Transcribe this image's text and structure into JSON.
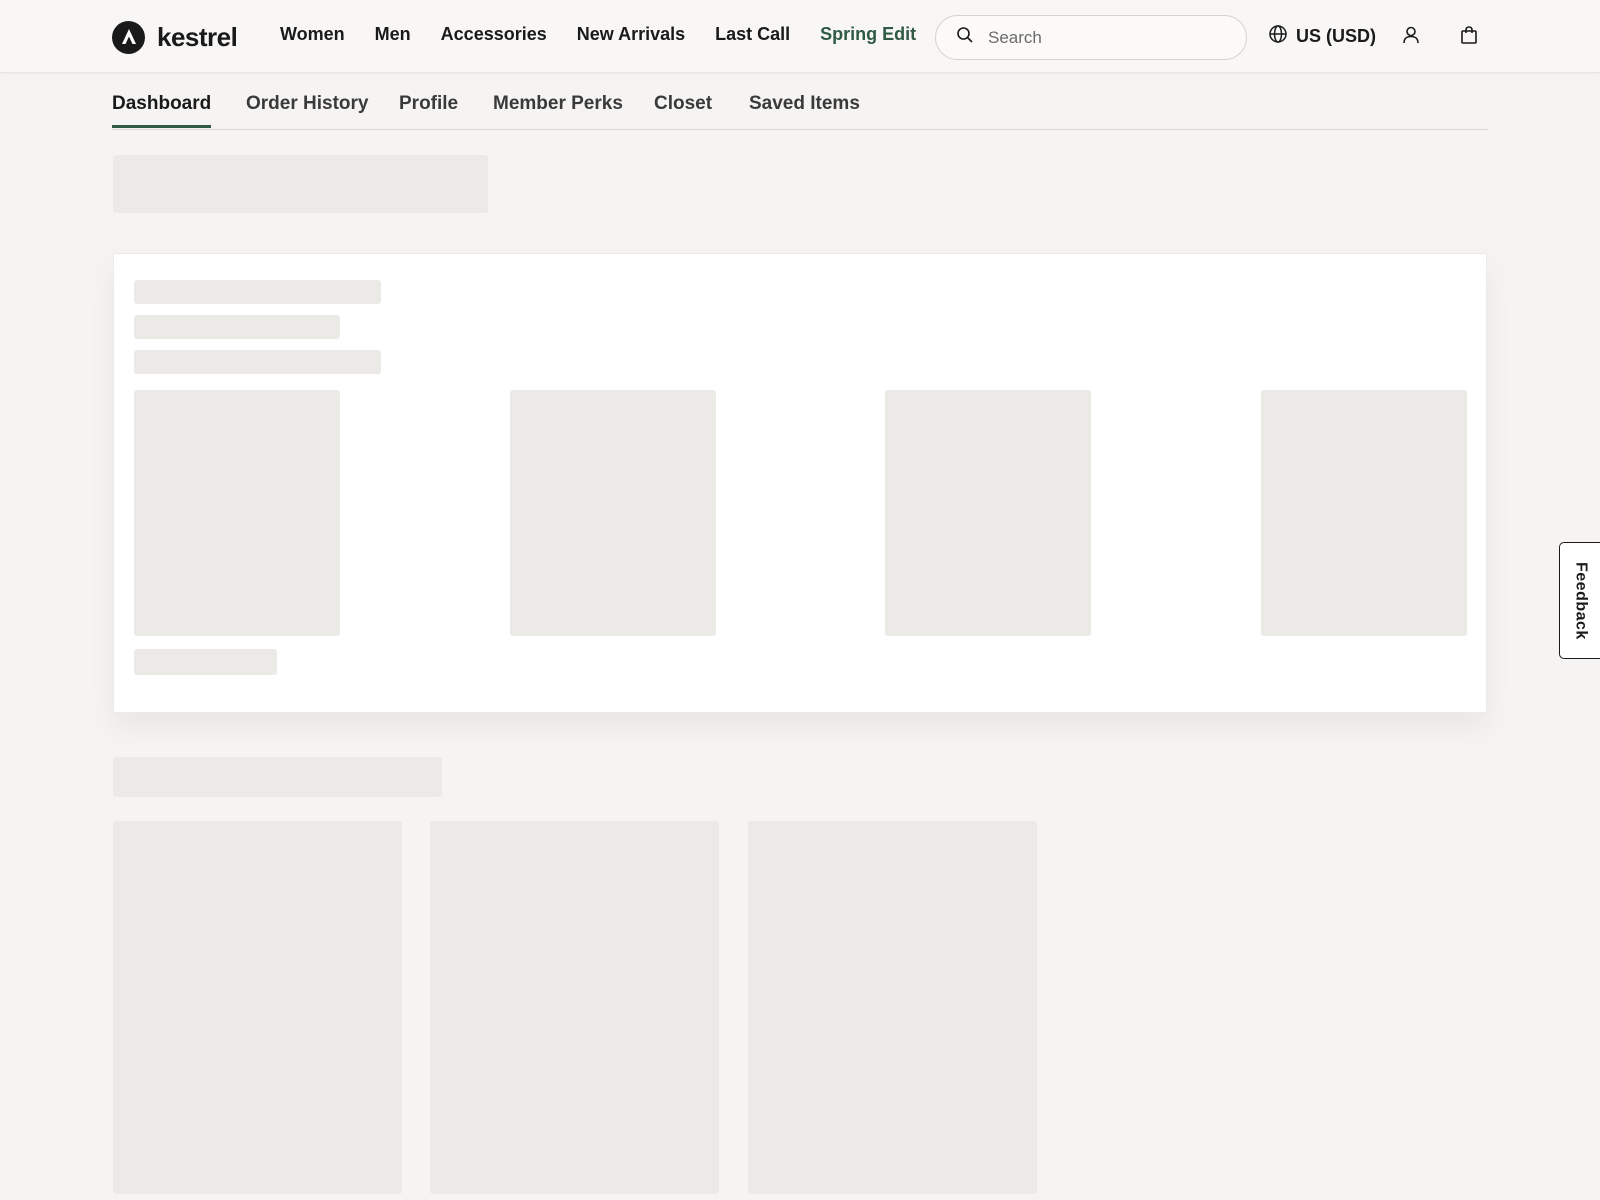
{
  "brand": {
    "name": "kestrel",
    "logo_icon": "kestrel-logo-icon"
  },
  "main_nav": [
    {
      "label": "Women"
    },
    {
      "label": "Men"
    },
    {
      "label": "Accessories"
    },
    {
      "label": "New Arrivals"
    },
    {
      "label": "Last Call"
    },
    {
      "label": "Spring Edit",
      "accent": true
    }
  ],
  "search": {
    "placeholder": "Search",
    "value": "",
    "icon": "search-icon"
  },
  "locale": {
    "label": "US (USD)",
    "icon": "globe-icon"
  },
  "header_icons": {
    "account": "user-icon",
    "cart": "shopping-bag-icon"
  },
  "account_tabs": [
    {
      "label": "Dashboard",
      "active": true
    },
    {
      "label": "Order History"
    },
    {
      "label": "Profile"
    },
    {
      "label": "Member Perks"
    },
    {
      "label": "Closet"
    },
    {
      "label": "Saved Items"
    }
  ],
  "feedback": {
    "label": "Feedback"
  },
  "colors": {
    "accent": "#2f5a44",
    "background": "#f5f4f2",
    "skeleton": "#ebeae7",
    "text": "#1a1a1a"
  }
}
